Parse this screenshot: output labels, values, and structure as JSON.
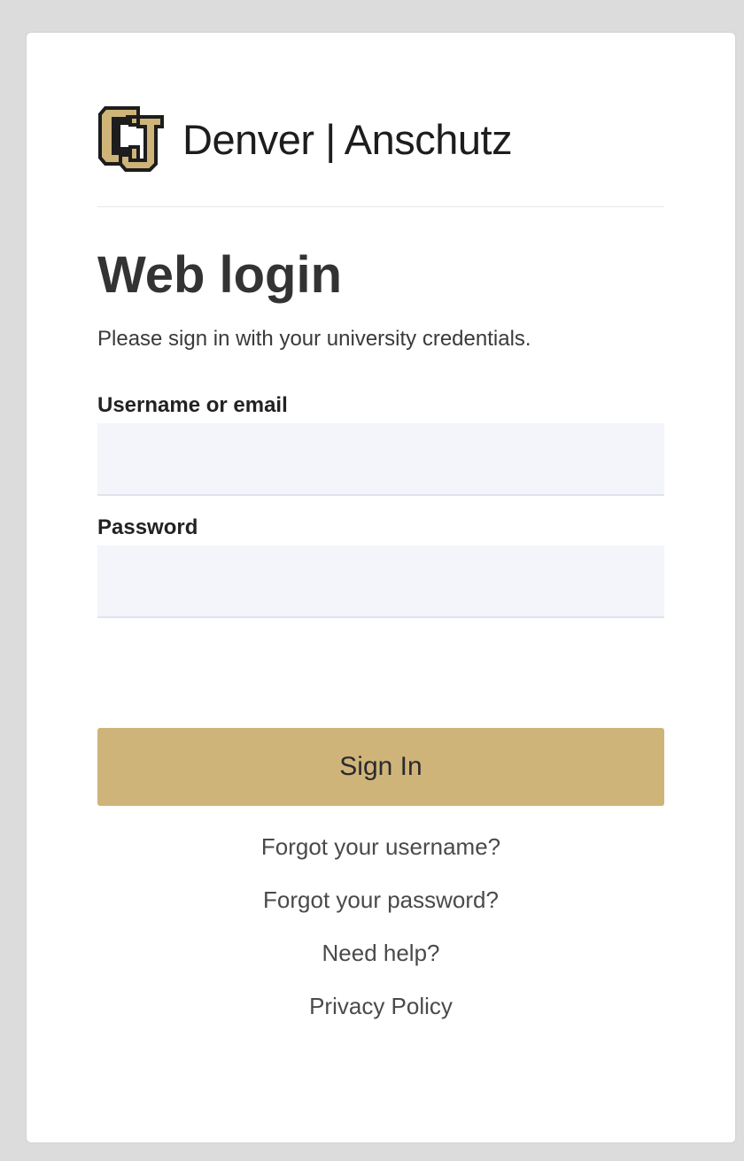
{
  "brand": {
    "name": "Denver | Anschutz",
    "logo_icon": "cu-logo-icon",
    "gold": "#cfb47a",
    "black": "#1d1d1d"
  },
  "login": {
    "title": "Web login",
    "subtitle": "Please sign in with your university credentials.",
    "username_label": "Username or email",
    "username_value": "",
    "username_placeholder": "",
    "password_label": "Password",
    "password_value": "",
    "password_placeholder": "",
    "sign_in_label": "Sign In"
  },
  "links": {
    "forgot_username": "Forgot your username?",
    "forgot_password": "Forgot your password?",
    "need_help": "Need help?",
    "privacy_policy": "Privacy Policy"
  },
  "colors": {
    "page_background": "#dcdcdc",
    "card_background": "#ffffff",
    "input_background": "#f4f5fa",
    "button_background": "#cfb47a"
  }
}
